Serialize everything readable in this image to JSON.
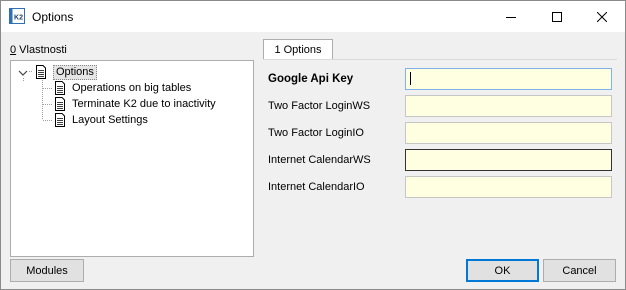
{
  "window": {
    "title": "Options",
    "app_icon": "k2-app-icon"
  },
  "tree_section": {
    "accelerator": "0",
    "label": " Vlastnosti"
  },
  "tree": {
    "root": {
      "label": "Options",
      "expanded": true
    },
    "children": [
      {
        "label": "Operations on big tables"
      },
      {
        "label": "Terminate K2 due to inactivity"
      },
      {
        "label": "Layout Settings"
      }
    ]
  },
  "tab": {
    "label": "1 Options"
  },
  "form": {
    "fields": [
      {
        "label": "Google Api Key",
        "value": "",
        "bold": true
      },
      {
        "label": "Two Factor LoginWS",
        "value": ""
      },
      {
        "label": "Two Factor LoginIO",
        "value": ""
      },
      {
        "label": "Internet CalendarWS",
        "value": ""
      },
      {
        "label": "Internet CalendarIO",
        "value": ""
      }
    ]
  },
  "buttons": {
    "modules": "Modules",
    "ok": "OK",
    "cancel": "Cancel"
  },
  "colors": {
    "input_bg": "#ffffe1",
    "focus_border": "#7eb4ea",
    "default_button_border": "#0078d7"
  }
}
